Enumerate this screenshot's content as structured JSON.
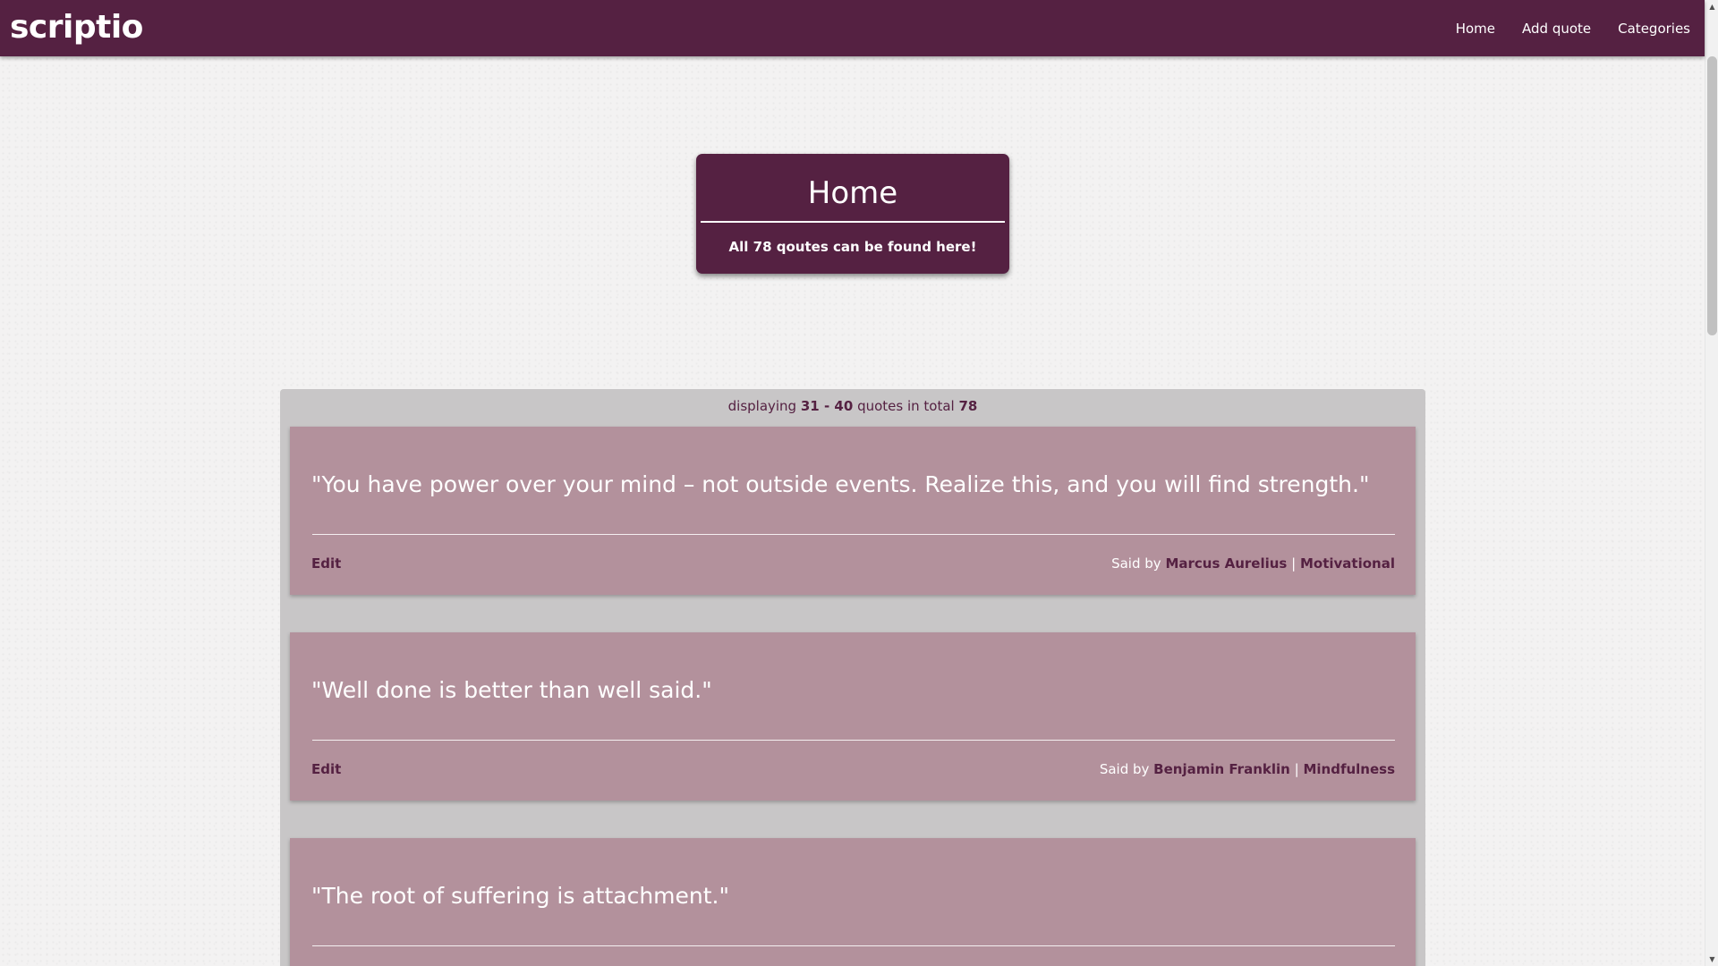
{
  "navbar": {
    "logo": "scriptio",
    "links": [
      "Home",
      "Add quote",
      "Categories"
    ]
  },
  "hero": {
    "title": "Home",
    "subtitle": "All 78 qoutes can be found here!"
  },
  "listing": {
    "prefix": "displaying",
    "range": "31 - 40",
    "middle": "quotes in total",
    "total": "78"
  },
  "quotes": [
    {
      "text": "\"You have power over your mind – not outside events. Realize this, and you will find strength.\"",
      "edit_label": "Edit",
      "said_by_label": "Said by",
      "author": "Marcus Aurelius",
      "separator": "|",
      "category": "Motivational"
    },
    {
      "text": "\"Well done is better than well said.\"",
      "edit_label": "Edit",
      "said_by_label": "Said by",
      "author": "Benjamin Franklin",
      "separator": "|",
      "category": "Mindfulness"
    },
    {
      "text": "\"The root of suffering is attachment.\""
    }
  ],
  "colors": {
    "brand": "#552142",
    "card": "#b3919c",
    "panel": "#c8c6c7"
  }
}
